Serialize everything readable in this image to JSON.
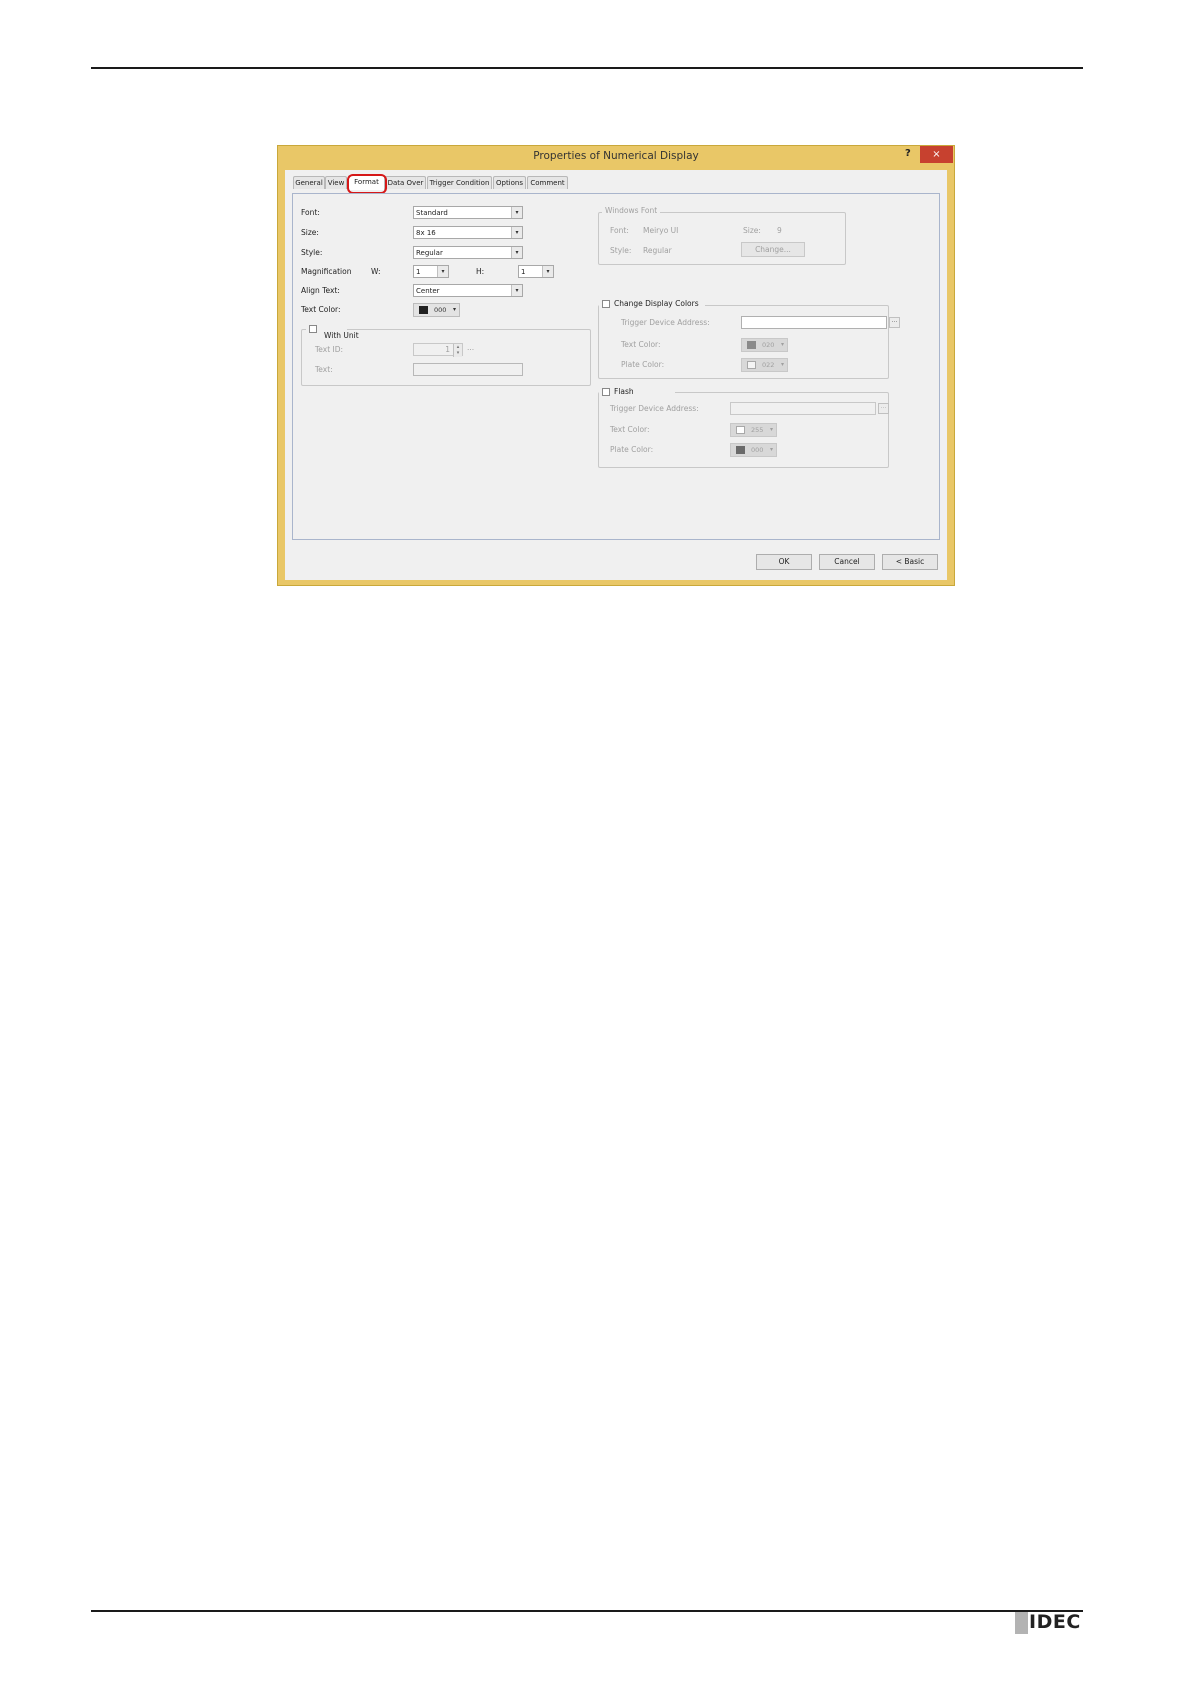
{
  "dialog": {
    "title": "Properties of Numerical Display",
    "help_label": "?",
    "close_label": "×",
    "tabs": [
      "General",
      "View",
      "Format",
      "Data Over",
      "Trigger Condition",
      "Options",
      "Comment"
    ],
    "active_tab": "Format"
  },
  "format": {
    "font_label": "Font:",
    "font_value": "Standard",
    "size_label": "Size:",
    "size_value": "8x 16",
    "style_label": "Style:",
    "style_value": "Regular",
    "magnification_label": "Magnification",
    "w_label": "W:",
    "w_value": "1",
    "h_label": "H:",
    "h_value": "1",
    "align_label": "Align Text:",
    "align_value": "Center",
    "text_color_label": "Text Color:",
    "text_color_value": "000",
    "text_color_hex": "#202020"
  },
  "with_unit": {
    "label": "With Unit",
    "text_id_label": "Text ID:",
    "text_id_value": "1",
    "text_label": "Text:",
    "ellipsis": "..."
  },
  "windows_font": {
    "group_label": "Windows Font",
    "font_label": "Font:",
    "font_value": "Meiryo UI",
    "size_label": "Size:",
    "size_value": "9",
    "style_label": "Style:",
    "style_value": "Regular",
    "change_button": "Change..."
  },
  "change_display_colors": {
    "label": "Change Display Colors",
    "trigger_label": "Trigger Device Address:",
    "ellipsis": "...",
    "text_color_label": "Text Color:",
    "text_color_value": "020",
    "text_color_hex": "#8a8a8a",
    "plate_color_label": "Plate Color:",
    "plate_color_value": "022",
    "plate_color_hex": "#f4f4f4"
  },
  "flash": {
    "label": "Flash",
    "trigger_label": "Trigger Device Address:",
    "ellipsis": "...",
    "text_color_label": "Text Color:",
    "text_color_value": "255",
    "text_color_hex": "#ffffff",
    "plate_color_label": "Plate Color:",
    "plate_color_value": "000",
    "plate_color_hex": "#6a6a6a"
  },
  "buttons": {
    "ok": "OK",
    "cancel": "Cancel",
    "basic": "< Basic"
  },
  "footer": {
    "logo_text": "IDEC"
  }
}
